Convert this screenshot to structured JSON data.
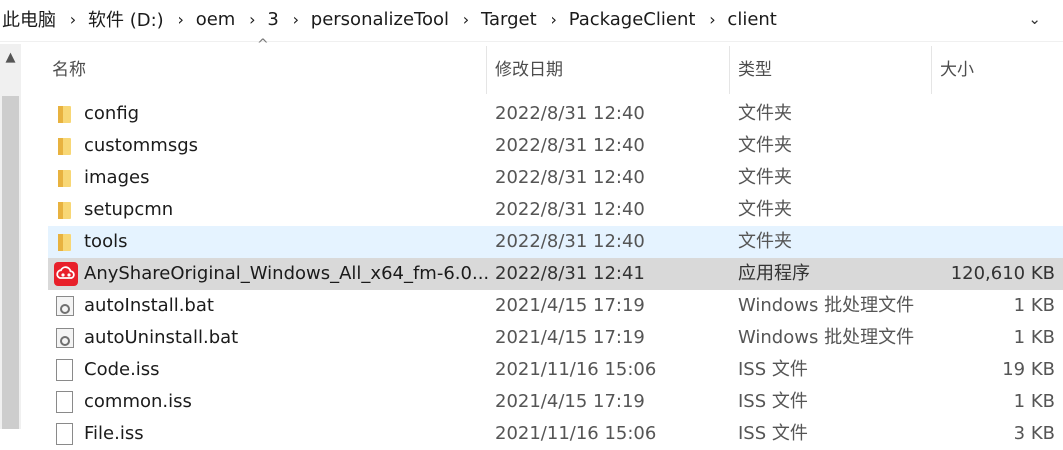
{
  "breadcrumb": {
    "items": [
      "此电脑",
      "软件 (D:)",
      "oem",
      "3",
      "personalizeTool",
      "Target",
      "PackageClient",
      "client"
    ]
  },
  "columns": {
    "name": "名称",
    "date": "修改日期",
    "type": "类型",
    "size": "大小"
  },
  "files": [
    {
      "name": "config",
      "date": "2022/8/31 12:40",
      "type": "文件夹",
      "size": "",
      "icon": "folder-icon"
    },
    {
      "name": "custommsgs",
      "date": "2022/8/31 12:40",
      "type": "文件夹",
      "size": "",
      "icon": "folder-icon"
    },
    {
      "name": "images",
      "date": "2022/8/31 12:40",
      "type": "文件夹",
      "size": "",
      "icon": "folder-icon"
    },
    {
      "name": "setupcmn",
      "date": "2022/8/31 12:40",
      "type": "文件夹",
      "size": "",
      "icon": "folder-icon"
    },
    {
      "name": "tools",
      "date": "2022/8/31 12:40",
      "type": "文件夹",
      "size": "",
      "icon": "folder-icon",
      "state": "hover"
    },
    {
      "name": "AnyShareOriginal_Windows_All_x64_fm-6.0....",
      "date": "2022/8/31 12:41",
      "type": "应用程序",
      "size": "120,610 KB",
      "icon": "app-icon",
      "state": "selected"
    },
    {
      "name": "autoInstall.bat",
      "date": "2021/4/15 17:19",
      "type": "Windows 批处理文件",
      "size": "1 KB",
      "icon": "bat-icon"
    },
    {
      "name": "autoUninstall.bat",
      "date": "2021/4/15 17:19",
      "type": "Windows 批处理文件",
      "size": "1 KB",
      "icon": "bat-icon"
    },
    {
      "name": "Code.iss",
      "date": "2021/11/16 15:06",
      "type": "ISS 文件",
      "size": "19 KB",
      "icon": "doc-icon"
    },
    {
      "name": "common.iss",
      "date": "2021/4/15 17:19",
      "type": "ISS 文件",
      "size": "1 KB",
      "icon": "doc-icon"
    },
    {
      "name": "File.iss",
      "date": "2021/11/16 15:06",
      "type": "ISS 文件",
      "size": "3 KB",
      "icon": "doc-icon"
    }
  ]
}
